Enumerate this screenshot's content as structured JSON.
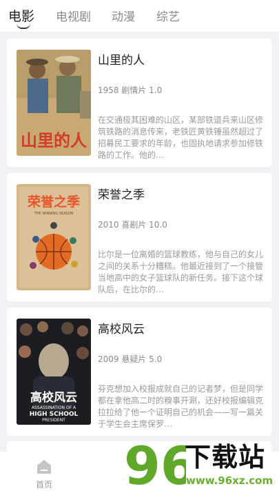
{
  "tabs": [
    {
      "label": "电影",
      "active": true
    },
    {
      "label": "电视剧",
      "active": false
    },
    {
      "label": "动漫",
      "active": false
    },
    {
      "label": "综艺",
      "active": false
    }
  ],
  "movies": [
    {
      "title": "山里的人",
      "meta": "1958 剧情片 1.0",
      "description": "在交通极其困难的山区，某部铁道兵来山区修筑铁路的消息传来，老铁匠黄铁锤虽然超过了招募民工要求的年龄，也固执地请求参加修铁路的工作。他的…",
      "poster_text": "山里的人"
    },
    {
      "title": "荣誉之季",
      "meta": "2010 喜剧片 10.0",
      "description": "比尔是一位离婚的篮球教练，他与自己的女儿之间的关系十分糟糕。他最近接到了一个接管当地高中的女子篮球队的新任务。接下这个球队后，在比尔的…",
      "poster_text": "荣誉之季",
      "poster_subtext": "THE WINNING SEASON"
    },
    {
      "title": "高校风云",
      "meta": "2009 悬疑片 5.0",
      "description": "芬克想加入校报成就自己的记者梦，但是同学都在拿他高二时的糗事开涮，还好校报编辑克拉拉给了他一个证明自己的机会——写一篇关于学生会主席保罗…",
      "poster_text": "高校风云",
      "poster_subtext_1": "ASSASSINATION OF A",
      "poster_subtext_2": "HIGH SCHOOL",
      "poster_subtext_3": "PRESIDENT"
    }
  ],
  "bottom_nav": {
    "home_label": "首页"
  },
  "watermark": {
    "logo_number": "96",
    "brand": "下载站",
    "url": "www.96xz.com"
  },
  "colors": {
    "background": "#f1f2f6",
    "card": "#ffffff",
    "watermark_green": "#6ab02e"
  }
}
